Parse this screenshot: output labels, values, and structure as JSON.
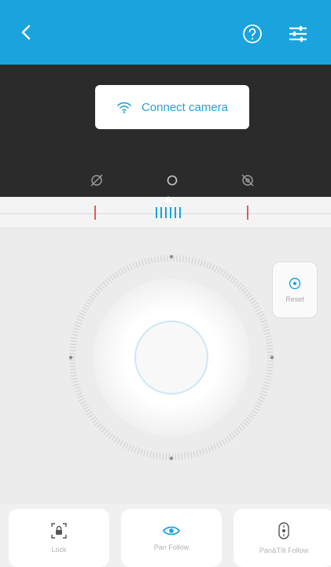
{
  "header": {
    "back_icon": "chevron-left-icon",
    "help_icon": "help-circle-icon",
    "menu_icon": "sliders-menu-icon",
    "background_color": "#1aa3dc"
  },
  "camera": {
    "connect_label": "Connect camera",
    "connect_icon": "wifi-icon",
    "modes": [
      "no-wifi-icon",
      "circle-mode-icon",
      "no-camera-icon"
    ]
  },
  "controls": {
    "reset_label": "Reset",
    "reset_icon": "recenter-icon"
  },
  "bottom_modes": [
    {
      "label": "Lock",
      "icon": "lock-icon"
    },
    {
      "label": "Pan Follow",
      "icon": "eye-icon"
    },
    {
      "label": "Pan&Tilt Follow",
      "icon": "tilt-follow-icon"
    }
  ]
}
